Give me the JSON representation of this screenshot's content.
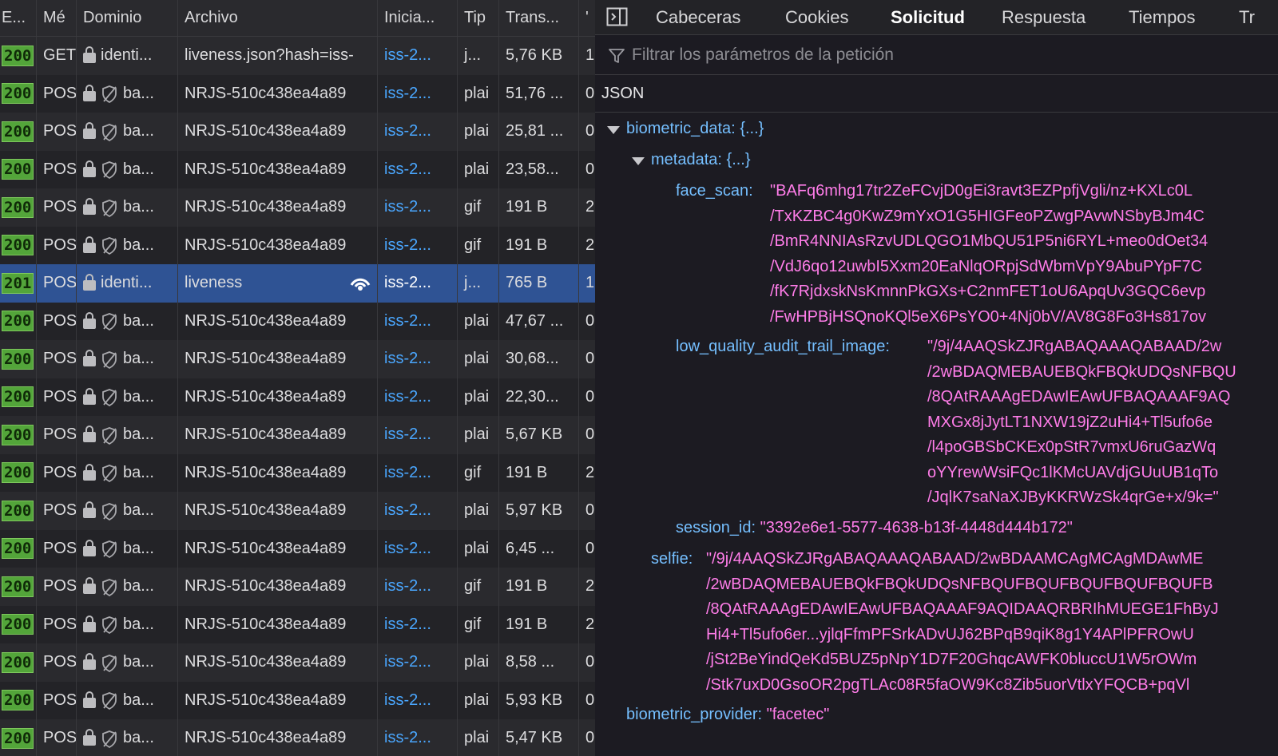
{
  "table": {
    "headers": {
      "status": "E...",
      "method": "Mé",
      "domain": "Dominio",
      "file": "Archivo",
      "initiator": "Inicia...",
      "type": "Tip",
      "transferred": "Trans...",
      "extra": "'"
    },
    "rows": [
      {
        "status": "200",
        "method": "GET",
        "domain": "identi...",
        "file": "liveness.json?hash=iss-",
        "initiator": "iss-2...",
        "type": "j...",
        "transferred": "5,76 KB",
        "extra": "1",
        "tracker": false
      },
      {
        "status": "200",
        "method": "POS",
        "domain": "ba...",
        "file": "NRJS-510c438ea4a89",
        "initiator": "iss-2...",
        "type": "plai",
        "transferred": "51,76 ...",
        "extra": "0",
        "tracker": true
      },
      {
        "status": "200",
        "method": "POS",
        "domain": "ba...",
        "file": "NRJS-510c438ea4a89",
        "initiator": "iss-2...",
        "type": "plai",
        "transferred": "25,81 ...",
        "extra": "0",
        "tracker": true
      },
      {
        "status": "200",
        "method": "POS",
        "domain": "ba...",
        "file": "NRJS-510c438ea4a89",
        "initiator": "iss-2...",
        "type": "plai",
        "transferred": "23,58...",
        "extra": "0",
        "tracker": true
      },
      {
        "status": "200",
        "method": "POS",
        "domain": "ba...",
        "file": "NRJS-510c438ea4a89",
        "initiator": "iss-2...",
        "type": "gif",
        "transferred": "191 B",
        "extra": "2",
        "tracker": true
      },
      {
        "status": "200",
        "method": "POS",
        "domain": "ba...",
        "file": "NRJS-510c438ea4a89",
        "initiator": "iss-2...",
        "type": "gif",
        "transferred": "191 B",
        "extra": "2",
        "tracker": true
      },
      {
        "status": "201",
        "method": "POS",
        "domain": "identi...",
        "file": "liveness",
        "initiator": "iss-2...",
        "type": "j...",
        "transferred": "765 B",
        "extra": "1",
        "tracker": false,
        "selected": true
      },
      {
        "status": "200",
        "method": "POS",
        "domain": "ba...",
        "file": "NRJS-510c438ea4a89",
        "initiator": "iss-2...",
        "type": "plai",
        "transferred": "47,67 ...",
        "extra": "0",
        "tracker": true
      },
      {
        "status": "200",
        "method": "POS",
        "domain": "ba...",
        "file": "NRJS-510c438ea4a89",
        "initiator": "iss-2...",
        "type": "plai",
        "transferred": "30,68...",
        "extra": "0",
        "tracker": true
      },
      {
        "status": "200",
        "method": "POS",
        "domain": "ba...",
        "file": "NRJS-510c438ea4a89",
        "initiator": "iss-2...",
        "type": "plai",
        "transferred": "22,30...",
        "extra": "0",
        "tracker": true
      },
      {
        "status": "200",
        "method": "POS",
        "domain": "ba...",
        "file": "NRJS-510c438ea4a89",
        "initiator": "iss-2...",
        "type": "plai",
        "transferred": "5,67 KB",
        "extra": "0",
        "tracker": true
      },
      {
        "status": "200",
        "method": "POS",
        "domain": "ba...",
        "file": "NRJS-510c438ea4a89",
        "initiator": "iss-2...",
        "type": "gif",
        "transferred": "191 B",
        "extra": "2",
        "tracker": true
      },
      {
        "status": "200",
        "method": "POS",
        "domain": "ba...",
        "file": "NRJS-510c438ea4a89",
        "initiator": "iss-2...",
        "type": "plai",
        "transferred": "5,97 KB",
        "extra": "0",
        "tracker": true
      },
      {
        "status": "200",
        "method": "POS",
        "domain": "ba...",
        "file": "NRJS-510c438ea4a89",
        "initiator": "iss-2...",
        "type": "plai",
        "transferred": "6,45 ...",
        "extra": "0",
        "tracker": true
      },
      {
        "status": "200",
        "method": "POS",
        "domain": "ba...",
        "file": "NRJS-510c438ea4a89",
        "initiator": "iss-2...",
        "type": "gif",
        "transferred": "191 B",
        "extra": "2",
        "tracker": true
      },
      {
        "status": "200",
        "method": "POS",
        "domain": "ba...",
        "file": "NRJS-510c438ea4a89",
        "initiator": "iss-2...",
        "type": "gif",
        "transferred": "191 B",
        "extra": "2",
        "tracker": true
      },
      {
        "status": "200",
        "method": "POS",
        "domain": "ba...",
        "file": "NRJS-510c438ea4a89",
        "initiator": "iss-2...",
        "type": "plai",
        "transferred": "8,58 ...",
        "extra": "0",
        "tracker": true
      },
      {
        "status": "200",
        "method": "POS",
        "domain": "ba...",
        "file": "NRJS-510c438ea4a89",
        "initiator": "iss-2...",
        "type": "plai",
        "transferred": "5,93 KB",
        "extra": "0",
        "tracker": true
      },
      {
        "status": "200",
        "method": "POS",
        "domain": "ba...",
        "file": "NRJS-510c438ea4a89",
        "initiator": "iss-2...",
        "type": "plai",
        "transferred": "5,47 KB",
        "extra": "0",
        "tracker": true
      }
    ]
  },
  "panel": {
    "tabs": [
      "Cabeceras",
      "Cookies",
      "Solicitud",
      "Respuesta",
      "Tiempos",
      "Tr"
    ],
    "active_tab": "Solicitud",
    "filter_placeholder": "Filtrar los parámetros de la petición",
    "section_label": "JSON",
    "json": {
      "biometric_data_key": "biometric_data:",
      "biometric_data_summary": "{...}",
      "metadata_key": "metadata:",
      "metadata_summary": "{...}",
      "face_scan_key": "face_scan:",
      "face_scan_lines": [
        "\"BAFq6mhg17tr2ZeFCvjD0gEi3ravt3EZPpfjVgli/nz+KXLc0L",
        "/TxKZBC4g0KwZ9mYxO1G5HIGFeoPZwgPAvwNSbyBJm4C",
        "/BmR4NNIAsRzvUDLQGO1MbQU51P5ni6RYL+meo0dOet34",
        "/VdJ6qo12uwbI5Xxm20EaNlqORpjSdWbmVpY9AbuPYpF7C",
        "/fK7RjdxskNsKmnnPkGXs+C2nmFET1oU6ApqUv3GQC6evp",
        "/FwHPBjHSQnoKQl5eX6PsYO0+4Nj0bV/AV8G8Fo3Hs817ov"
      ],
      "low_quality_key": "low_quality_audit_trail_image:",
      "low_quality_lines": [
        "\"/9j/4AAQSkZJRgABAQAAAQABAAD/2w",
        "/2wBDAQMEBAUEBQkFBQkUDQsNFBQU",
        "/8QAtRAAAgEDAwIEAwUFBAQAAAF9AQ",
        "MXGx8jJytLT1NXW19jZ2uHi4+Tl5ufo6e",
        "/l4poGBSbCKEx0pStR7vmxU6ruGazWq",
        "oYYrewWsiFQc1lKMcUAVdjGUuUB1qTo",
        "/JqlK7saNaXJByKKRWzSk4qrGe+x/9k=\""
      ],
      "session_key": "session_id:",
      "session_value": "\"3392e6e1-5577-4638-b13f-4448d444b172\"",
      "selfie_key": "selfie:",
      "selfie_lines": [
        "\"/9j/4AAQSkZJRgABAQAAAQABAAD/2wBDAAMCAgMCAgMDAwME",
        "/2wBDAQMEBAUEBQkFBQkUDQsNFBQUFBQUFBQUFBQUFBQUFB",
        "/8QAtRAAAgEDAwIEAwUFBAQAAAF9AQIDAAQRBRIhMUEGE1FhByJ",
        "Hi4+Tl5ufo6er...yjlqFfmPFSrkADvUJ62BPqB9qiK8g1Y4APlPFROwU",
        "/jSt2BeYindQeKd5BUZ5pNpY1D7F20GhqcAWFK0bluccU1W5rOWm",
        "/Stk7uxD0GsoOR2pgTLAc08R5faOW9Kc8Zib5uorVtlxYFQCB+pqVl"
      ],
      "provider_key": "biometric_provider:",
      "provider_value": "\"facetec\""
    }
  },
  "colors": {
    "accent_selected_row": "#2f5394",
    "status_badge": "#53a53a",
    "json_key": "#75bfff",
    "json_string": "#ff7de9"
  },
  "icons": [
    "lock-icon",
    "tracker-icon",
    "network-icon",
    "dock-toggle-icon",
    "filter-icon",
    "expand-triangle-icon"
  ]
}
